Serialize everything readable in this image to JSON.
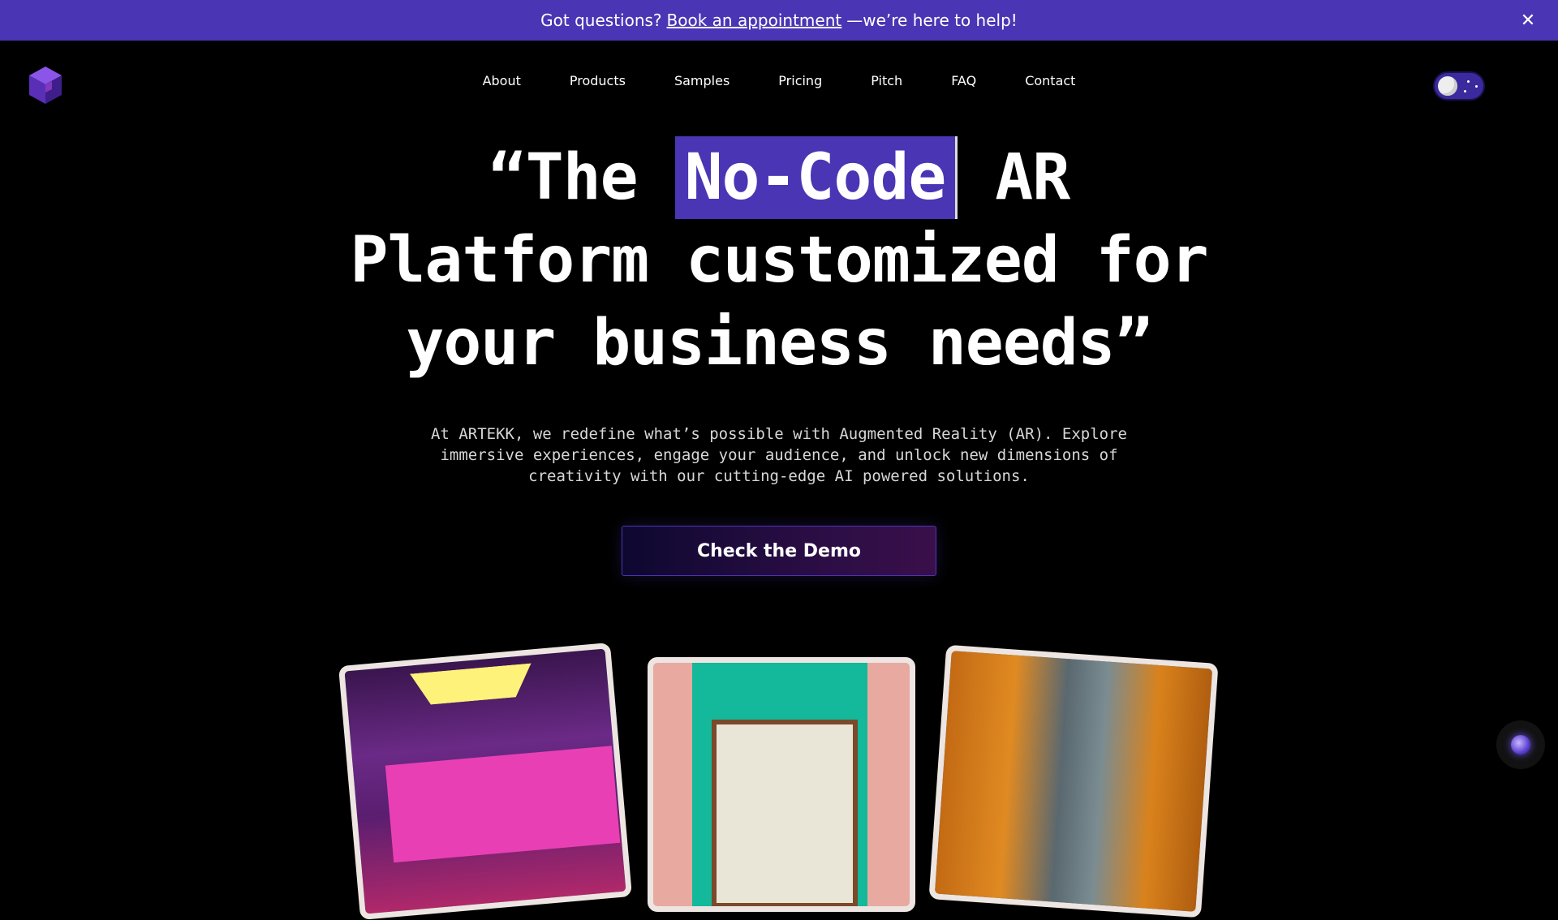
{
  "banner": {
    "text_before": "Got questions?",
    "link": "Book an appointment",
    "text_after": "—we’re here to help!",
    "close_glyph": "✕"
  },
  "nav": {
    "items": [
      {
        "label": "About"
      },
      {
        "label": "Products"
      },
      {
        "label": "Samples"
      },
      {
        "label": "Pricing"
      },
      {
        "label": "Pitch"
      },
      {
        "label": "FAQ"
      },
      {
        "label": "Contact"
      }
    ]
  },
  "theme_toggle": {
    "state": "dark"
  },
  "hero": {
    "line1_before": "“The ",
    "highlight": "No-Code",
    "line1_after": " AR",
    "line2": "Platform customized for",
    "line3": "your business needs”",
    "subtitle": "At ARTEKK, we redefine what’s possible with Augmented Reality (AR). Explore immersive experiences, engage your audience, and unlock new dimensions of creativity with our cutting-edge AI powered solutions.",
    "cta_label": "Check the Demo"
  },
  "colors": {
    "accent": "#4a35b4",
    "background": "#000000"
  },
  "icons": {
    "logo": "cube-logo-icon",
    "close": "close-icon",
    "chat": "chat-orb-icon"
  }
}
